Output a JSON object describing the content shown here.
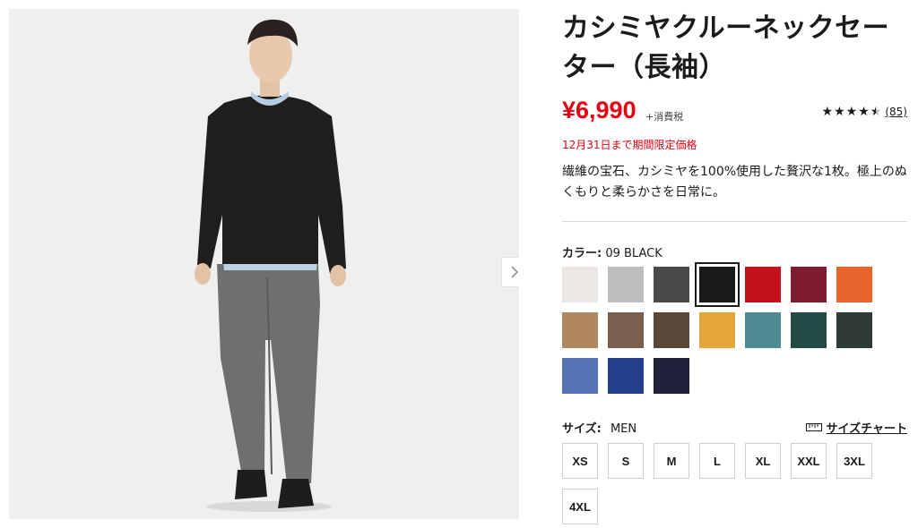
{
  "product": {
    "title": "カシミヤクルーネックセーター（長袖）",
    "price": "¥6,990",
    "tax_note": "+消費税",
    "rating_stars": 4.5,
    "review_count": "(85)",
    "limited_notice": "12月31日まで期間限定価格",
    "description": "繊維の宝石、カシミヤを100%使用した贅沢な1枚。極上のぬくもりと柔らかさを日常に。"
  },
  "color": {
    "label": "カラー:",
    "selected": "09 BLACK",
    "swatches": [
      "#ebe8e3",
      "#bdbdbd",
      "#4a4a4a",
      "#1c1a18",
      "#c4111e",
      "#7e1b2e",
      "#e8642a",
      "#b0865d",
      "#7a5e4e",
      "#5a4738",
      "#e3a63a",
      "#4f8a92",
      "#244a46",
      "#2e3a35",
      "#5674b4",
      "#24408a",
      "#1f2238"
    ],
    "selected_index": 3
  },
  "size": {
    "label": "サイズ:",
    "category": "MEN",
    "chart_link": "サイズチャート",
    "options": [
      "XS",
      "S",
      "M",
      "L",
      "XL",
      "XXL",
      "3XL",
      "4XL"
    ]
  },
  "icons": {
    "next": "chevron-right-icon",
    "ruler": "ruler-icon",
    "star": "star-icon"
  }
}
